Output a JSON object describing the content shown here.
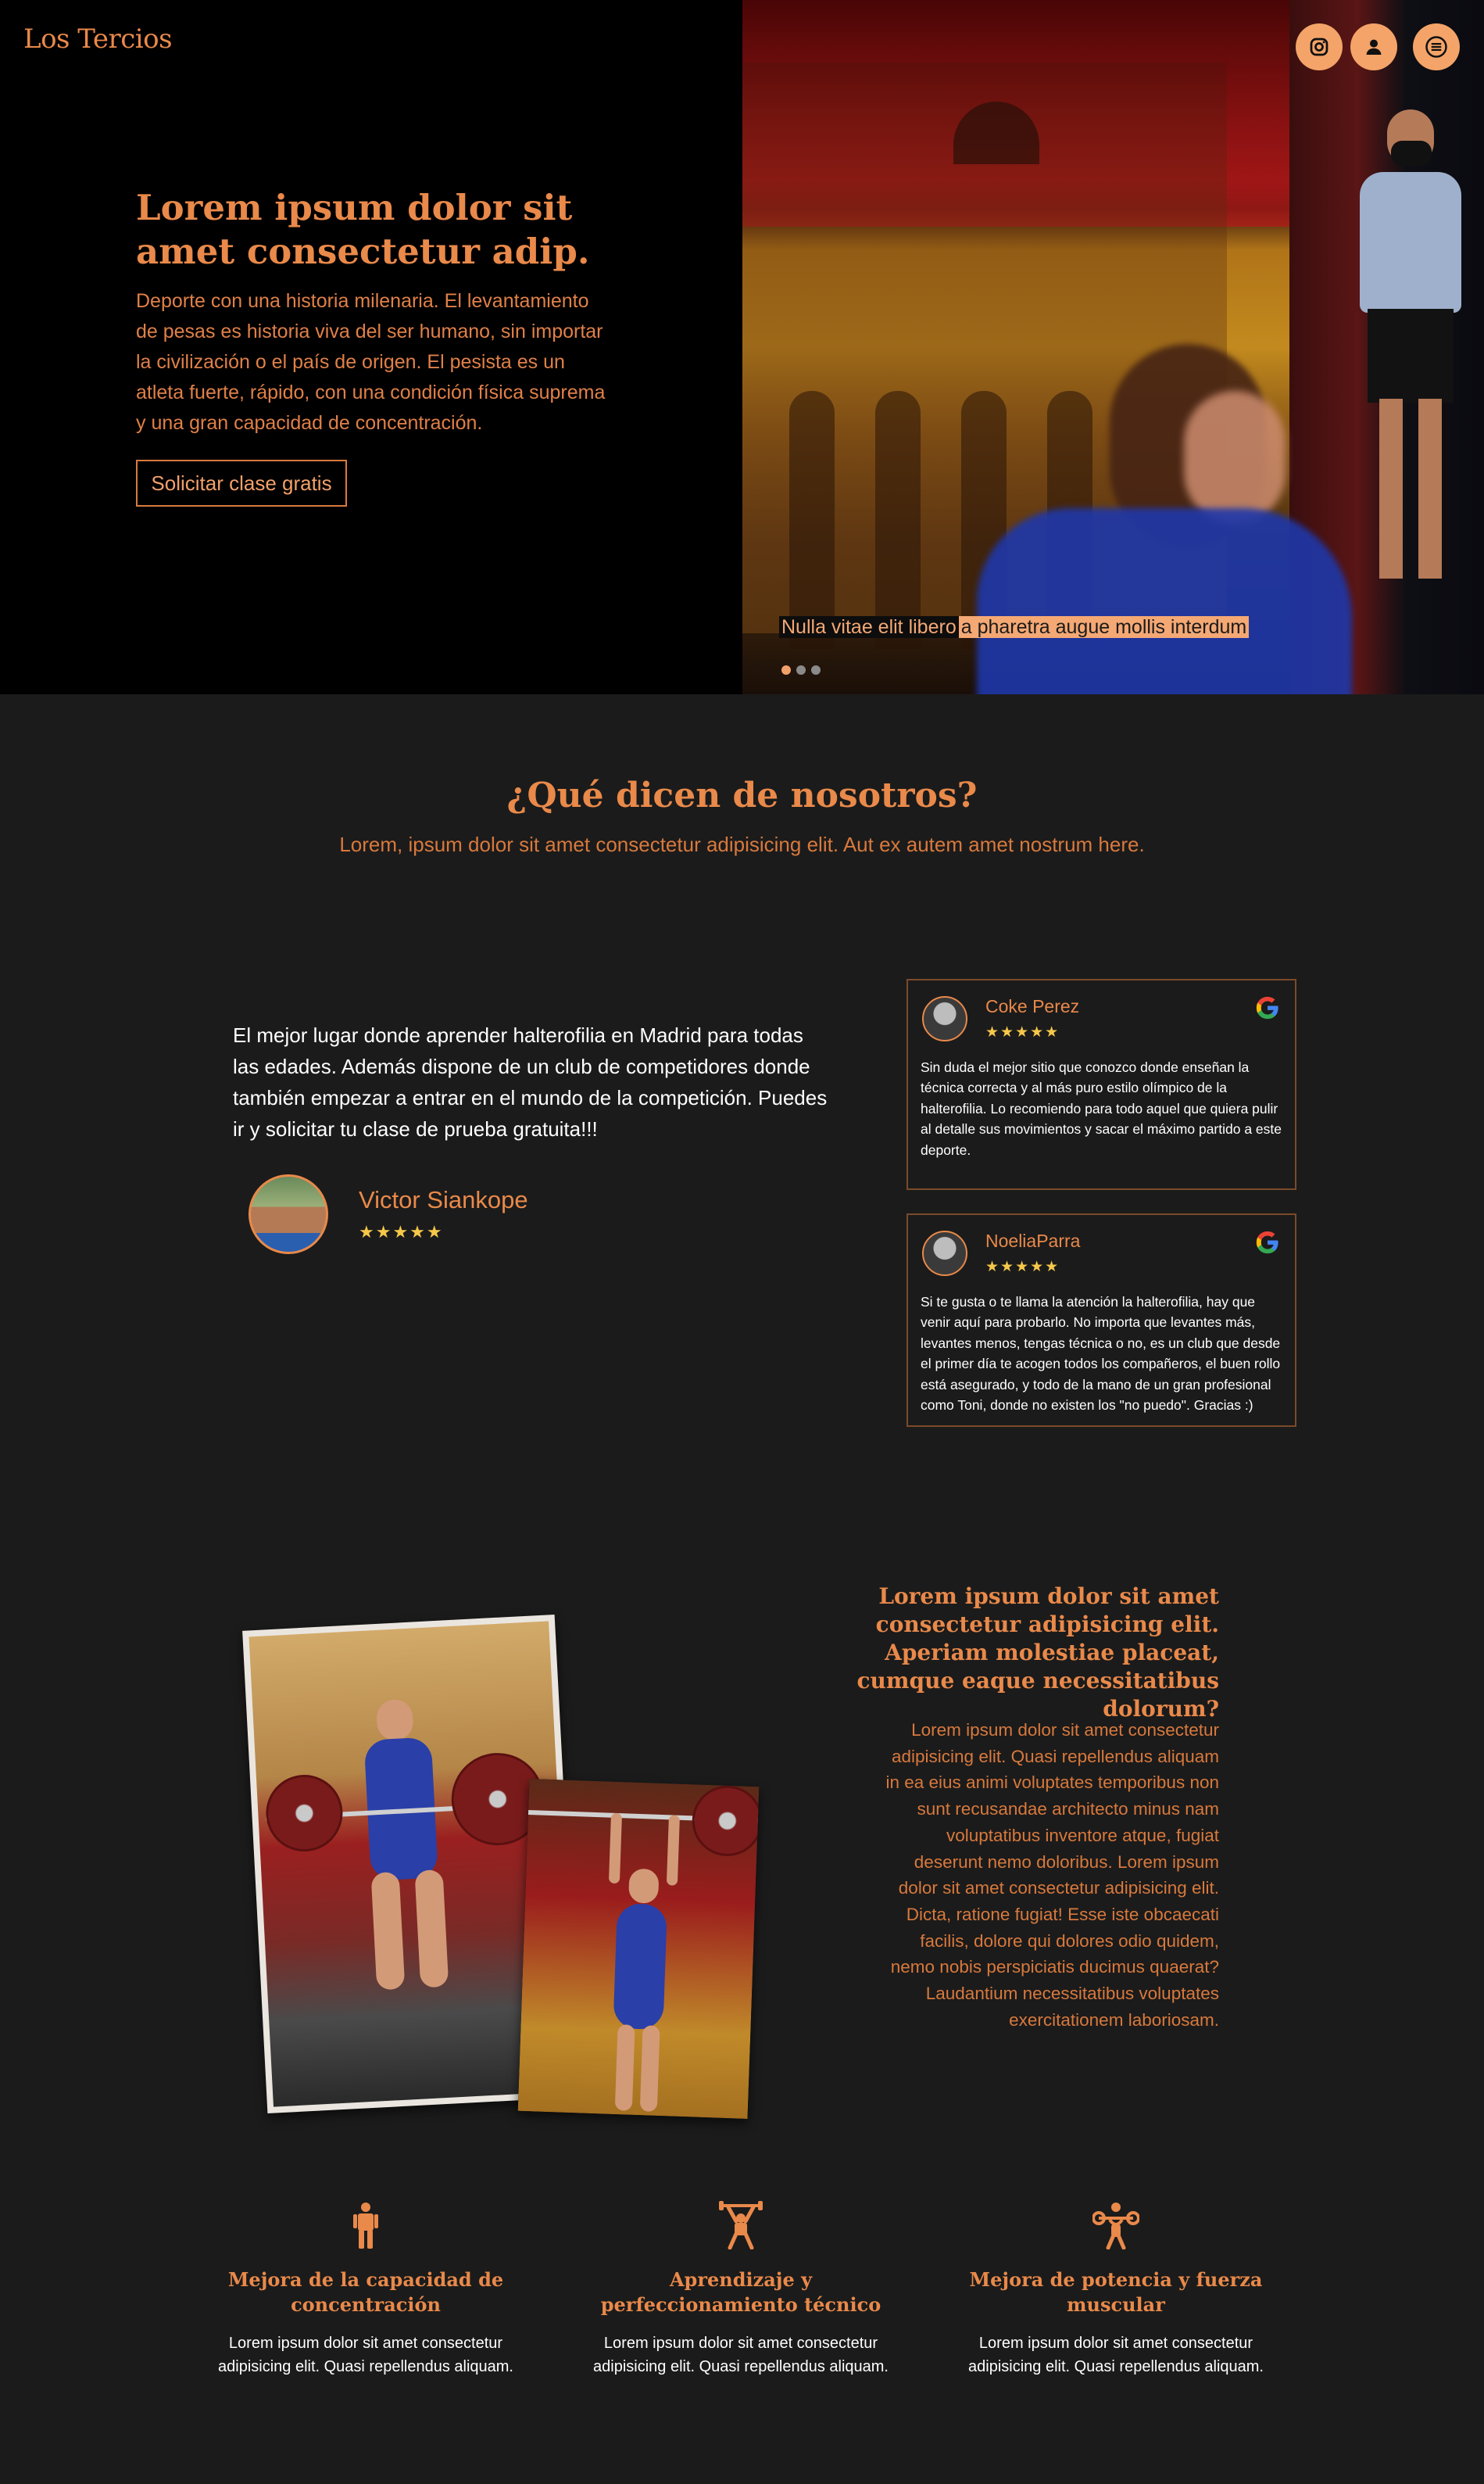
{
  "brand": "Los Tercios",
  "hero": {
    "title": "Lorem ipsum dolor sit amet consectetur adip.",
    "text": "Deporte con una historia milenaria. El levantamiento de pesas es historia viva del ser humano, sin importar la civilización o el país de origen. El pesista es un atleta fuerte, rápido, con una condición física suprema y una gran capacidad de concentración.",
    "cta_label": "Solicitar clase gratis",
    "caption_dark": "Nulla vitae elit libero",
    "caption_light": "a pharetra augue mollis interdum",
    "slide_count": 3,
    "active_slide": 1
  },
  "header_icons": [
    "instagram-icon",
    "user-icon",
    "menu-icon"
  ],
  "testimonials": {
    "title": "¿Qué dicen de nosotros?",
    "subtitle": "Lorem, ipsum dolor sit amet consectetur adipisicing elit. Aut ex autem amet nostrum here.",
    "featured": {
      "quote": "El mejor lugar donde aprender halterofilia en Madrid para todas las edades. Además dispone de un club de competidores donde también empezar a entrar en el mundo de la competición. Puedes ir y solicitar tu clase de prueba gratuita!!!",
      "author": "Victor Siankope",
      "stars": "★★★★★"
    },
    "reviews": [
      {
        "name": "Coke Perez",
        "stars": "★★★★★",
        "text": "Sin duda el mejor sitio que conozco donde enseñan la técnica correcta y al más puro estilo olímpico de la halterofilia. Lo recomiendo para todo aquel que quiera pulir al detalle sus movimientos y sacar el máximo partido a este deporte."
      },
      {
        "name": "NoeliaParra",
        "stars": "★★★★★",
        "text": "Si te gusta o te llama la atención la halterofilia, hay que venir aquí para probarlo. No importa que levantes más, levantes menos, tengas técnica o no, es un club que desde el primer día te acogen todos los compañeros, el buen rollo está asegurado, y todo de la mano de un gran profesional como Toni, donde no existen los \"no puedo\". Gracias :)"
      }
    ]
  },
  "feature": {
    "title": "Lorem ipsum dolor sit amet consectetur adipisicing elit. Aperiam molestiae placeat, cumque eaque necessitatibus dolorum?",
    "text": "Lorem ipsum dolor sit amet consectetur adipisicing elit. Quasi repellendus aliquam in ea eius animi voluptates temporibus non sunt recusandae architecto minus nam voluptatibus inventore atque, fugiat deserunt nemo doloribus. Lorem ipsum dolor sit amet consectetur adipisicing elit. Dicta, ratione fugiat! Esse iste obcaecati facilis, dolore qui dolores odio quidem, nemo nobis perspiciatis ducimus quaerat? Laudantium necessitatibus voluptates exercitationem laboriosam."
  },
  "benefits": [
    {
      "icon": "person-standing-icon",
      "title": "Mejora de la capacidad de concentración",
      "text": "Lorem ipsum dolor sit amet consectetur adipisicing elit. Quasi repellendus aliquam."
    },
    {
      "icon": "weightlifter-icon",
      "title": "Aprendizaje y perfeccionamiento técnico",
      "text": "Lorem ipsum dolor sit amet consectetur adipisicing elit. Quasi repellendus aliquam."
    },
    {
      "icon": "power-lift-icon",
      "title": "Mejora de potencia y fuerza muscular",
      "text": "Lorem ipsum dolor sit amet consectetur adipisicing elit. Quasi repellendus aliquam."
    }
  ],
  "colors": {
    "accent": "#e9894a",
    "button_fill": "#f4a468",
    "stars": "#f6c84a",
    "background": "#1b1b1b",
    "hero_background": "#000000"
  }
}
